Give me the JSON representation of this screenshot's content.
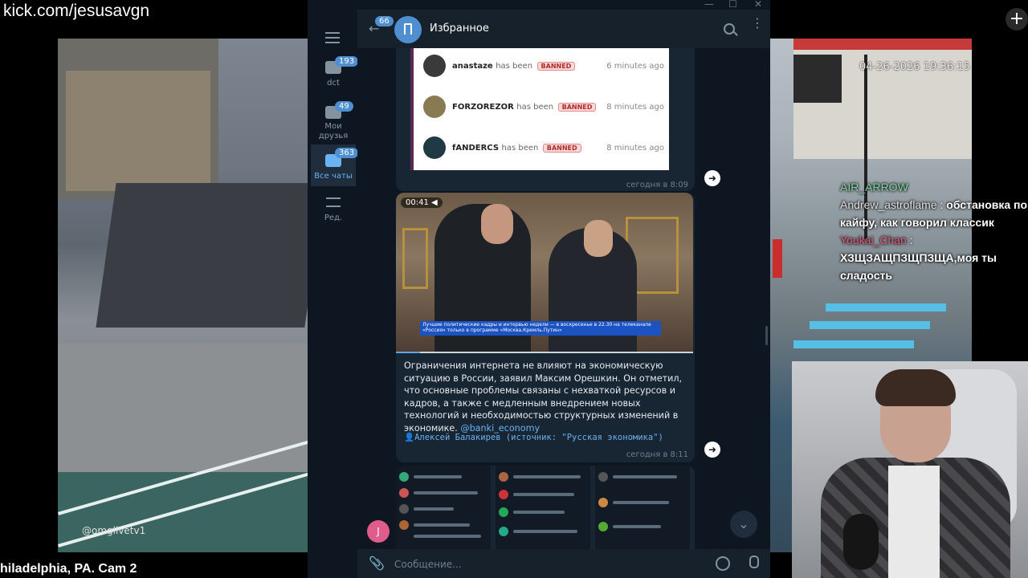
{
  "stream": {
    "url": "kick.com/jesusavgn",
    "left_cam_caption": "hiladelphia, PA. Cam 2",
    "left_cam_watermark": "@omglivetv1",
    "right_cam_timestamp": "04-26-2026 19:36:15",
    "add_button": "+"
  },
  "stream_chat": [
    {
      "user": "AIR_ARROW",
      "message": ""
    },
    {
      "user": "Andrew_astroflame",
      "message": "обстановка по кайфу, как говорил классик"
    },
    {
      "user": "Youkai_Chan",
      "message": "ХЗЩЗАЩПЗЩПЗЩА,моя ты сладость"
    }
  ],
  "telegram": {
    "sidebar": {
      "items": [
        {
          "label": "dct",
          "badge": "193"
        },
        {
          "label": "Мои друзья",
          "badge": "49"
        },
        {
          "label": "Все чаты",
          "badge": "363"
        },
        {
          "label": "Ред.",
          "badge": ""
        }
      ]
    },
    "header": {
      "back_badge": "66",
      "title": "Избранное"
    },
    "messages": {
      "bans": [
        {
          "name": "anastaze",
          "text": "has been",
          "tag": "BANNED",
          "time": "6 minutes ago"
        },
        {
          "name": "FORZOREZOR",
          "text": "has been",
          "tag": "BANNED",
          "time": "8 minutes ago"
        },
        {
          "name": "fANDERCS",
          "text": "has been",
          "tag": "BANNED",
          "time": "8 minutes ago"
        }
      ],
      "msg1_time": "сегодня в 8:09",
      "video_time": "00:41",
      "video_progress": 0.08,
      "video_ticker": "Лучшие политические кадры и интервью недели — в воскресенье в 22.30 на телеканале «Россия» только в программе «Москва.Кремль.Путин»",
      "msg2_text": "Ограничения интернета не влияют на экономическую ситуацию в России, заявил Максим Орешкин. Он отметил, что основные проблемы связаны с нехваткой ресурсов и кадров, а также с медленным внедрением новых технологий и необходимостью структурных изменений в экономике.",
      "msg2_link": "@banki_economy",
      "msg2_sign": "👤Алексей Балакирев (источник: \"Русская экономика\")",
      "msg2_time": "сегодня в 8:11",
      "avatar_letter": "J"
    },
    "composer": {
      "placeholder": "Сообщение..."
    }
  }
}
